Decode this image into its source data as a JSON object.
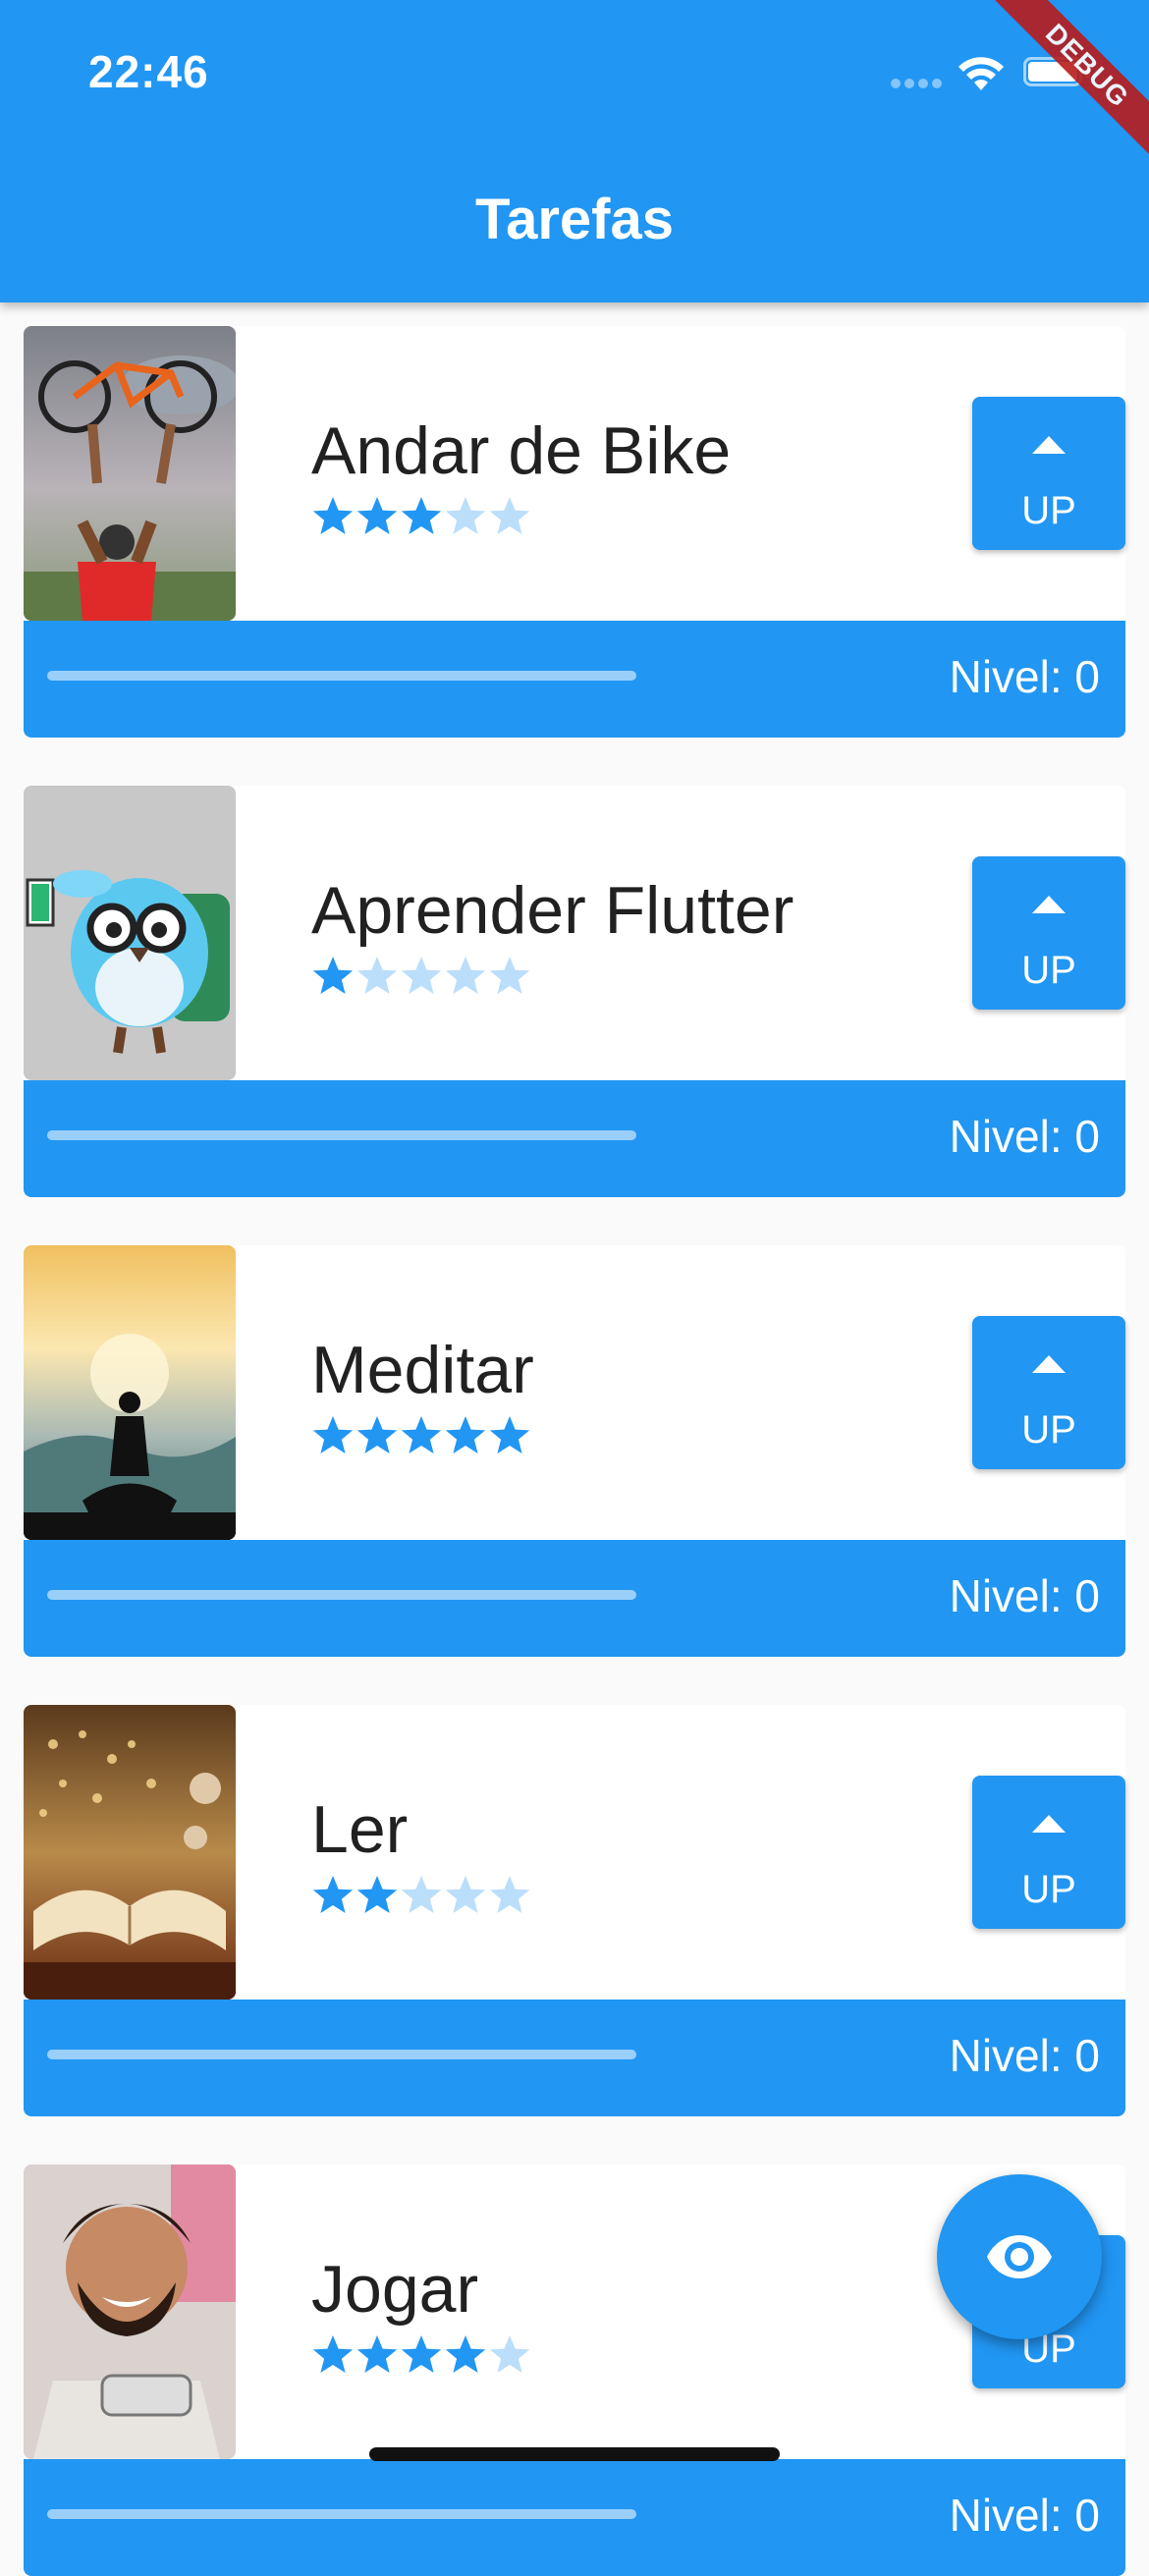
{
  "status_bar": {
    "time": "22:46"
  },
  "debug_banner": "DEBUG",
  "app_bar": {
    "title": "Tarefas"
  },
  "tasks": [
    {
      "name": "Andar de Bike",
      "difficulty": 3,
      "max_difficulty": 5,
      "button_label": "UP",
      "level_label": "Nivel: 0",
      "progress": 0,
      "image": "bike-photo"
    },
    {
      "name": "Aprender Flutter",
      "difficulty": 1,
      "max_difficulty": 5,
      "button_label": "UP",
      "level_label": "Nivel: 0",
      "progress": 0,
      "image": "flutter-mascot"
    },
    {
      "name": "Meditar",
      "difficulty": 5,
      "max_difficulty": 5,
      "button_label": "UP",
      "level_label": "Nivel: 0",
      "progress": 0,
      "image": "meditation-photo"
    },
    {
      "name": "Ler",
      "difficulty": 2,
      "max_difficulty": 5,
      "button_label": "UP",
      "level_label": "Nivel: 0",
      "progress": 0,
      "image": "book-photo"
    },
    {
      "name": "Jogar",
      "difficulty": 4,
      "max_difficulty": 5,
      "button_label": "UP",
      "level_label": "Nivel: 0",
      "progress": 0,
      "image": "gamer-photo"
    }
  ],
  "fab": {
    "icon": "eye-icon"
  },
  "colors": {
    "primary": "#2196f3",
    "star_active": "#2196f3",
    "star_inactive": "#bbdefb"
  }
}
